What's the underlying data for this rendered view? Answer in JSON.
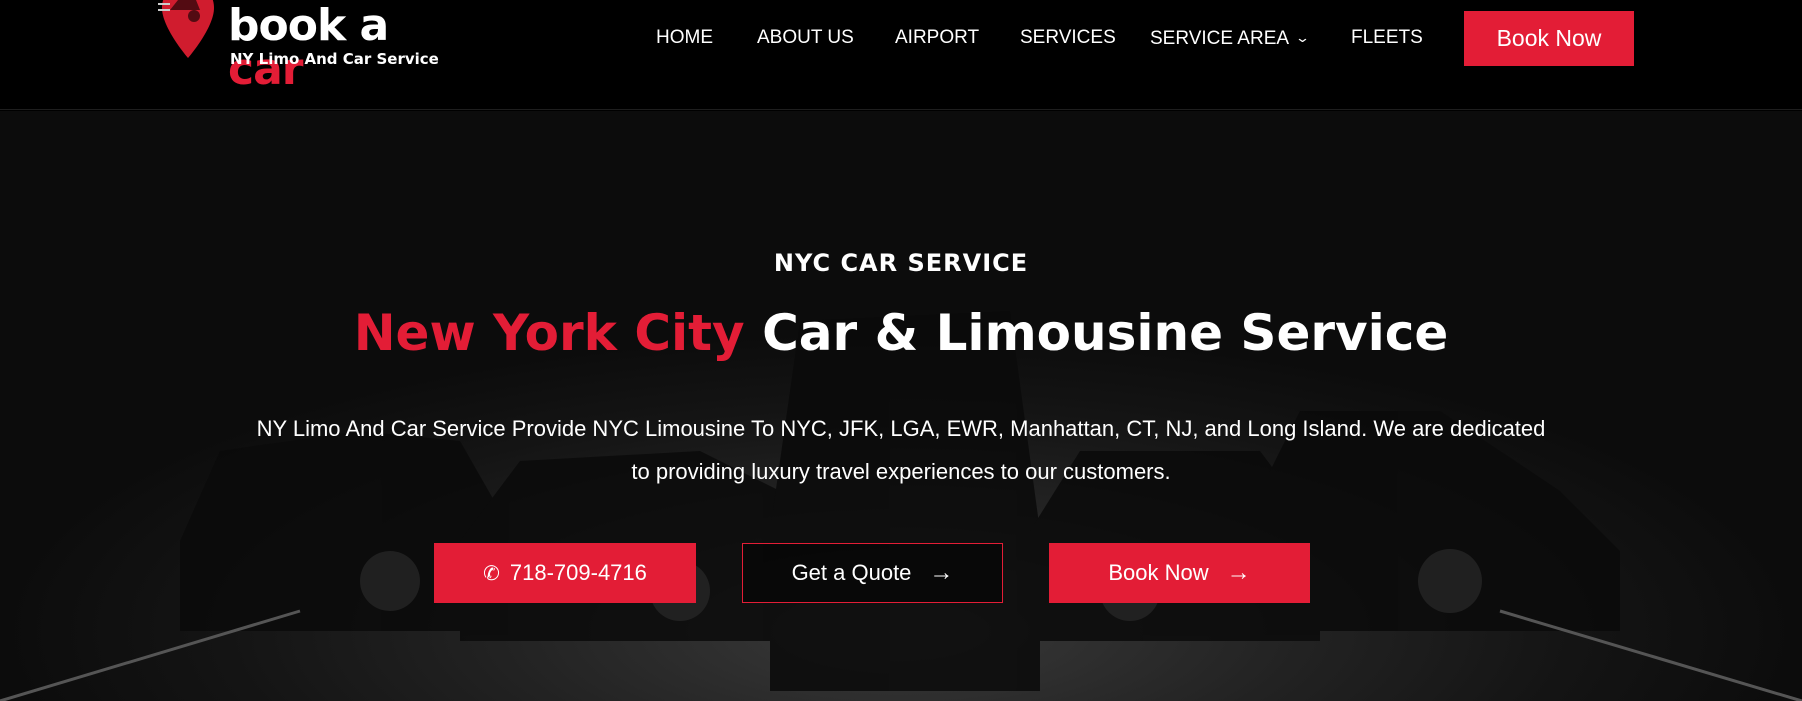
{
  "header": {
    "logo": {
      "brand_main": "book a ",
      "brand_accent": "car",
      "tagline": "NY Limo And Car Service"
    },
    "nav": [
      {
        "label": "HOME"
      },
      {
        "label": "ABOUT US"
      },
      {
        "label": "AIRPORT"
      },
      {
        "label": "SERVICES"
      },
      {
        "label": "SERVICE AREA",
        "has_dropdown": true
      },
      {
        "label": "FLEETS"
      }
    ],
    "book_now_label": "Book Now"
  },
  "hero": {
    "eyebrow": "NYC CAR SERVICE",
    "title_accent": "New York City",
    "title_rest": " Car & Limousine Service",
    "description": "NY Limo And Car Service Provide NYC Limousine To NYC, JFK, LGA, EWR, Manhattan, CT, NJ, and Long Island. We are dedicated to providing luxury travel experiences to our customers.",
    "buttons": {
      "phone": {
        "label": "718-709-4716",
        "icon": "phone-icon"
      },
      "quote": {
        "label": "Get a Quote",
        "icon": "arrow-right-icon"
      },
      "book": {
        "label": "Book Now",
        "icon": "arrow-right-icon"
      }
    }
  },
  "colors": {
    "accent": "#e31d36",
    "background": "#000000"
  }
}
